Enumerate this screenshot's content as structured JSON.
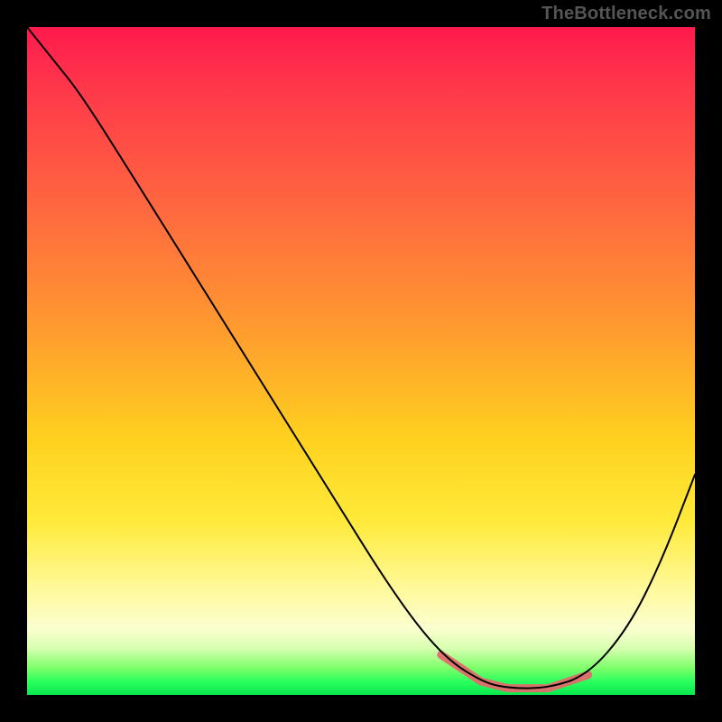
{
  "watermark": "TheBottleneck.com",
  "colors": {
    "frame_background": "#000000",
    "curve": "#000000",
    "highlight_segment": "#e26b6b",
    "gradient_stops": [
      "#ff1a4d",
      "#ff6a3f",
      "#ffd21f",
      "#fbffd0",
      "#2bff5e"
    ]
  },
  "chart_data": {
    "type": "line",
    "title": "",
    "xlabel": "",
    "ylabel": "",
    "xlim": [
      0,
      1
    ],
    "ylim": [
      0,
      1
    ],
    "series": [
      {
        "name": "bottleneck-curve",
        "x": [
          0.0,
          0.04,
          0.08,
          0.15,
          0.25,
          0.35,
          0.45,
          0.55,
          0.62,
          0.68,
          0.72,
          0.78,
          0.84,
          0.9,
          0.95,
          1.0
        ],
        "y": [
          1.0,
          0.95,
          0.9,
          0.79,
          0.63,
          0.47,
          0.31,
          0.15,
          0.06,
          0.02,
          0.01,
          0.01,
          0.03,
          0.1,
          0.2,
          0.33
        ]
      }
    ],
    "annotations": [
      {
        "name": "optimal-range-highlight",
        "x_range": [
          0.62,
          0.84
        ],
        "y": 0.01,
        "color": "#e26b6b"
      }
    ],
    "grid": false,
    "legend": false
  }
}
